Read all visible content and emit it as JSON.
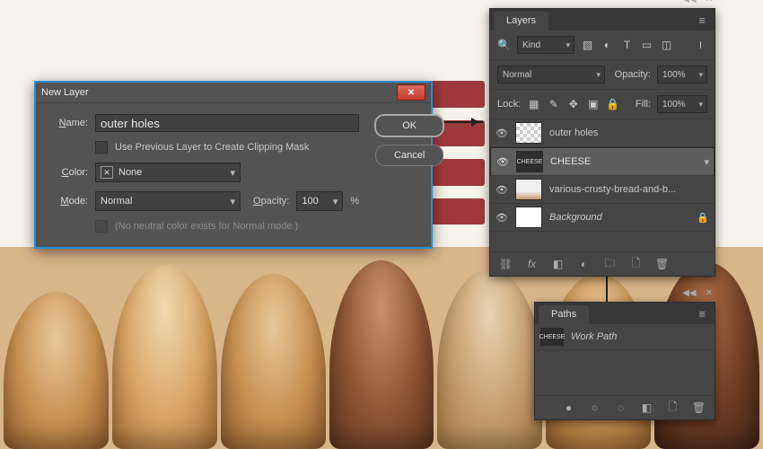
{
  "dialog": {
    "title": "New Layer",
    "name_label": "Name:",
    "name_value": "outer holes",
    "clip_label": "Use Previous Layer to Create Clipping Mask",
    "color_label": "Color:",
    "color_value": "None",
    "mode_label": "Mode:",
    "mode_value": "Normal",
    "opacity_label": "Opacity:",
    "opacity_value": "100",
    "opacity_suffix": "%",
    "neutral_note": "(No neutral color exists for Normal mode.)",
    "ok": "OK",
    "cancel": "Cancel"
  },
  "layers": {
    "tab": "Layers",
    "filter_kind": "Kind",
    "blend_mode": "Normal",
    "opacity_label": "Opacity:",
    "opacity_value": "100%",
    "lock_label": "Lock:",
    "fill_label": "Fill:",
    "fill_value": "100%",
    "items": [
      {
        "name": "outer holes",
        "visible": true,
        "thumb": "checker"
      },
      {
        "name": "CHEESE",
        "visible": true,
        "thumb": "cheese",
        "selected": true
      },
      {
        "name": "various-crusty-bread-and-b...",
        "visible": true,
        "thumb": "bread"
      },
      {
        "name": "Background",
        "visible": true,
        "thumb": "white",
        "locked": true,
        "italic": true
      }
    ]
  },
  "paths": {
    "tab": "Paths",
    "items": [
      {
        "name": "Work Path"
      }
    ]
  }
}
